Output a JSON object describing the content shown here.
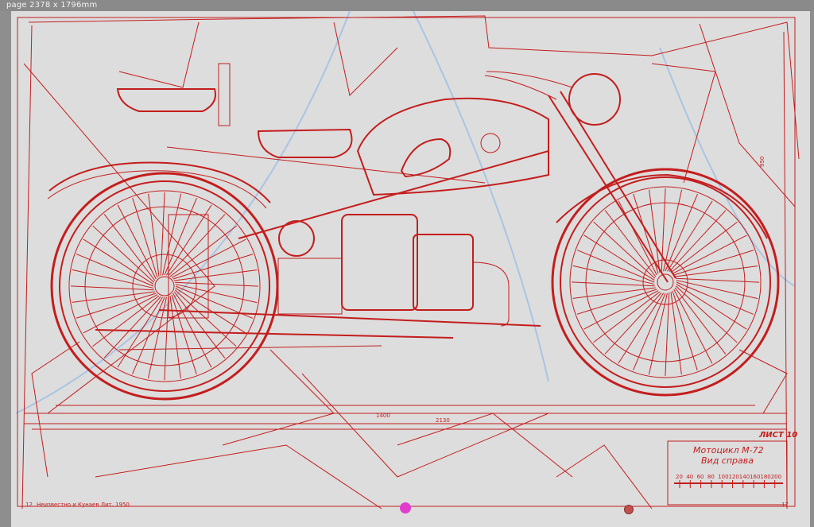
{
  "window": {
    "page_label": "page 2378 x 1796mm"
  },
  "drawing": {
    "dim_wheelbase": "1400",
    "dim_overall_length": "2130",
    "height_dim": "950",
    "sheet_tag": "ЛИСТ 10",
    "title_line1": "Мотоцикл М-72",
    "title_line2": "Вид справа",
    "scale_ticks": [
      "20",
      "40",
      "60",
      "80",
      "100",
      "120",
      "140",
      "160",
      "180",
      "200"
    ],
    "footer_left_number": "12",
    "footer_left_text": "Неизвестно и Кунаев   Лит. 1950",
    "footer_right_number": "17"
  },
  "colors": {
    "line": "#c41d1d",
    "guide": "#a9c4e4",
    "handle_active": "#e23ccf",
    "handle_secondary": "#c0504d"
  }
}
